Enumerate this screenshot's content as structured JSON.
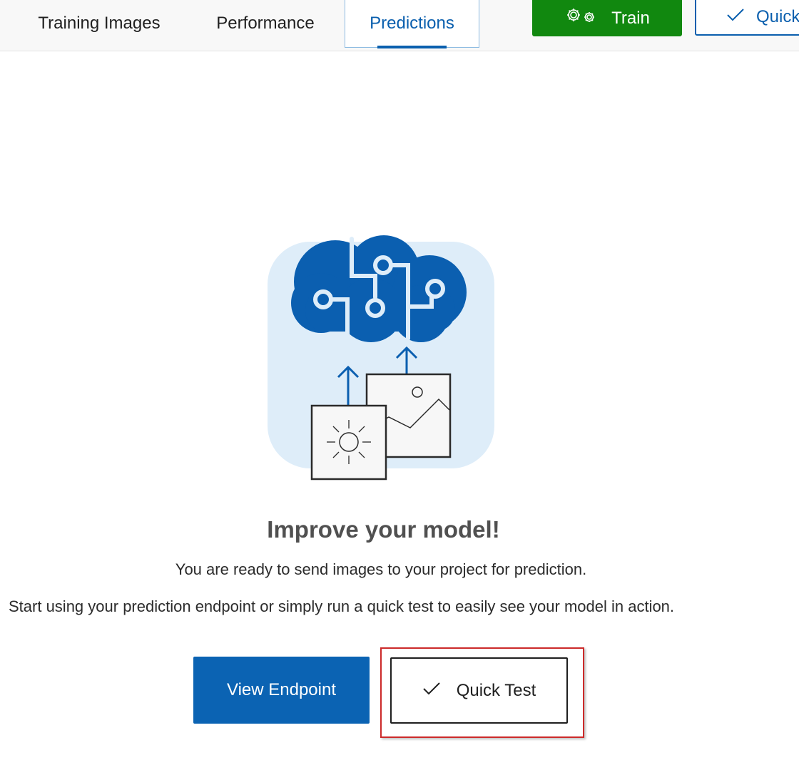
{
  "tabs": {
    "training_images": "Training Images",
    "performance": "Performance",
    "predictions": "Predictions",
    "active": "Predictions"
  },
  "toolbar": {
    "train_label": "Train",
    "quick_test_label": "Quick Test"
  },
  "empty_state": {
    "headline": "Improve your model!",
    "line1": "You are ready to send images to your project for prediction.",
    "line2": "Start using your prediction endpoint or simply run a quick test to easily see your model in action."
  },
  "actions": {
    "view_endpoint_label": "View Endpoint",
    "quick_test_label": "Quick Test"
  },
  "colors": {
    "accent_blue": "#0a5fae",
    "train_green": "#11880f",
    "highlight_red": "#cc2a2a",
    "illustration_bg": "#deedf9"
  },
  "icons": {
    "train": "gears-icon",
    "quick_test": "checkmark-icon",
    "illustration": "cloud-brain-with-images-illustration"
  }
}
